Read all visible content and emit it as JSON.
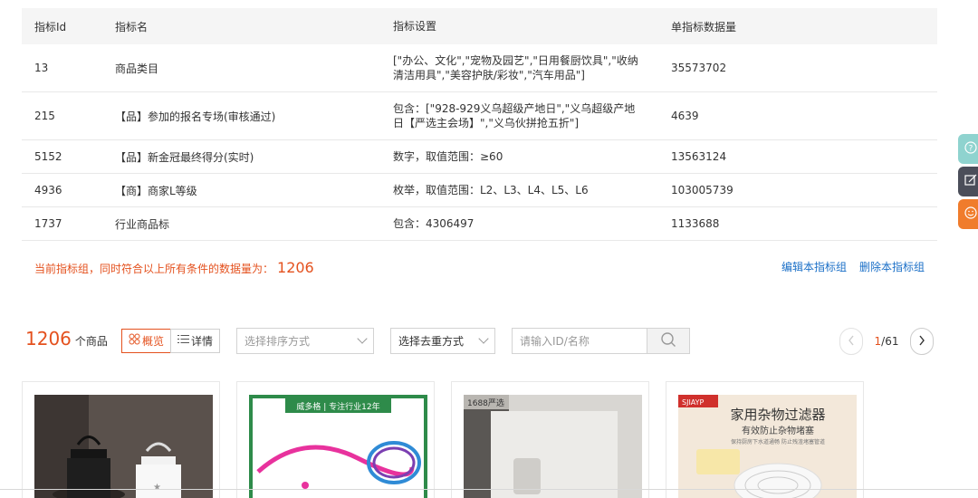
{
  "table": {
    "headers": [
      "指标Id",
      "指标名",
      "指标设置",
      "单指标数据量"
    ],
    "rows": [
      {
        "id": "13",
        "name": "商品类目",
        "setting": "[\"办公、文化\",\"宠物及园艺\",\"日用餐厨饮具\",\"收纳清洁用具\",\"美容护肤/彩妆\",\"汽车用品\"]",
        "count": "35573702"
      },
      {
        "id": "215",
        "name": "【品】参加的报名专场(审核通过)",
        "setting": "包含：[\"928-929义乌超级产地日\",\"义乌超级产地日【严选主会场】\",\"义乌伙拼抢五折\"]",
        "count": "4639"
      },
      {
        "id": "5152",
        "name": "【品】新金冠最终得分(实时)",
        "setting": "数字，取值范围：≥60",
        "count": "13563124"
      },
      {
        "id": "4936",
        "name": "【商】商家L等级",
        "setting": "枚举，取值范围：L2、L3、L4、L5、L6",
        "count": "103005739"
      },
      {
        "id": "1737",
        "name": "行业商品标",
        "setting": "包含：4306497",
        "count": "1133688"
      }
    ]
  },
  "summary": {
    "label": "当前指标组，同时符合以上所有条件的数据量为：",
    "value": "1206"
  },
  "group_actions": {
    "edit": "编辑本指标组",
    "delete": "删除本指标组"
  },
  "toolbar": {
    "count": "1206",
    "count_unit": "个商品",
    "view_overview": "概览",
    "view_detail": "详情",
    "sort_placeholder": "选择排序方式",
    "dedupe_label": "选择去重方式",
    "search_placeholder": "请输入ID/名称"
  },
  "pager": {
    "current": "1",
    "total": "/61"
  },
  "cards": [
    {
      "icon": "product-lantern-image"
    },
    {
      "icon": "product-leash-image",
      "banner": "威多格 | 专注行业12年"
    },
    {
      "icon": "product-hook-image",
      "tag": "1688严选"
    },
    {
      "icon": "product-drain-filter-image",
      "brand": "SJIAYP",
      "title": "家用杂物过滤器",
      "sub": "有效防止杂物堵塞",
      "small": "保持厨房下水道通畅 防止残渣堵塞管道"
    }
  ],
  "colors": {
    "accent": "#e4511e",
    "link": "#1a6fc7",
    "header_bg": "#f5f5f5"
  }
}
